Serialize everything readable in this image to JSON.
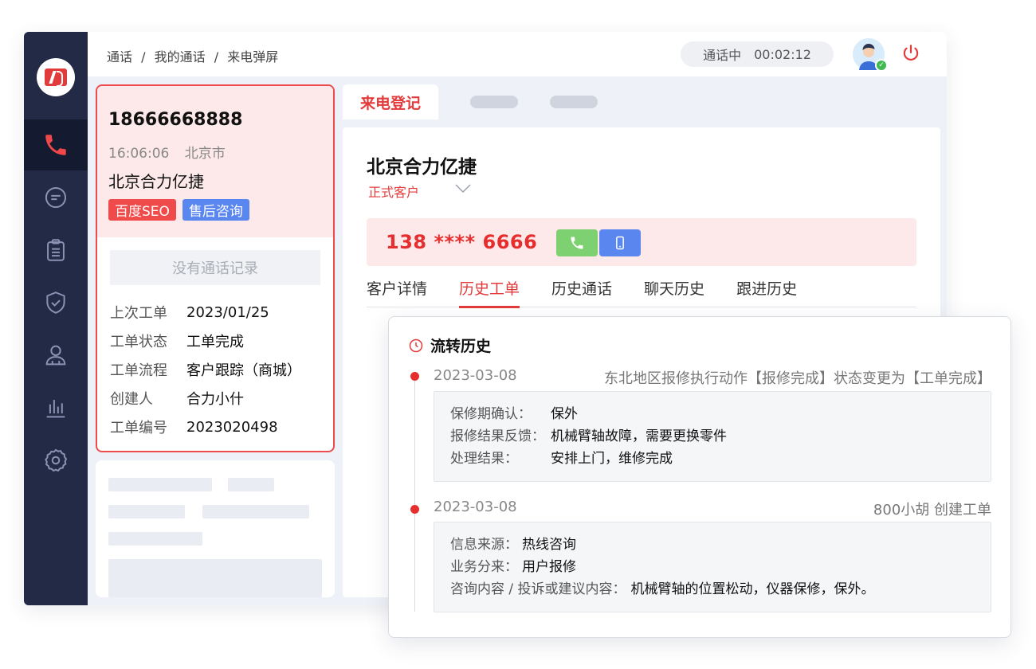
{
  "breadcrumb": [
    "通话",
    "/",
    "我的通话",
    "/",
    "来电弹屏"
  ],
  "call_status": {
    "label": "通话中",
    "timer": "00:02:12"
  },
  "caller": {
    "number": "18666668888",
    "time": "16:06:06",
    "city": "北京市",
    "company": "北京合力亿捷",
    "tags": [
      "百度SEO",
      "售后咨询"
    ],
    "no_record": "没有通话记录",
    "info": [
      {
        "label": "上次工单",
        "value": "2023/01/25"
      },
      {
        "label": "工单状态",
        "value": "工单完成"
      },
      {
        "label": "工单流程",
        "value": "客户跟踪（商城）"
      },
      {
        "label": "创建人",
        "value": "合力小什"
      },
      {
        "label": "工单编号",
        "value": "2023020498"
      }
    ]
  },
  "main": {
    "active_tab": "来电登记",
    "customer_name": "北京合力亿捷",
    "customer_type": "正式客户",
    "masked_phone": "138 **** 6666",
    "sub_tabs": [
      "客户详情",
      "历史工单",
      "历史通话",
      "聊天历史",
      "跟进历史"
    ],
    "active_sub_tab": 1
  },
  "history": {
    "title": "流转历史",
    "entries": [
      {
        "date": "2023-03-08",
        "desc": "东北地区报修执行动作【报修完成】状态变更为【工单完成】",
        "rows": [
          {
            "k": "保修期确认：",
            "v": "保外"
          },
          {
            "k": "报修结果反馈：",
            "v": "机械臂轴故障，需要更换零件"
          },
          {
            "k": "处理结果：",
            "v": "安排上门，维修完成"
          }
        ]
      },
      {
        "date": "2023-03-08",
        "desc": "800小胡 创建工单",
        "rows": [
          {
            "k": "信息来源：",
            "v": "热线咨询"
          },
          {
            "k": "业务分来：",
            "v": "用户报修"
          },
          {
            "k": "咨询内容 / 投诉或建议内容：",
            "v": "机械臂轴的位置松动，仪器保修，保外。"
          }
        ]
      }
    ]
  },
  "colors": {
    "accent_red": "#e33b3b",
    "sidebar": "#232a45",
    "call_green": "#7ed170",
    "mobile_blue": "#5a86ef"
  }
}
